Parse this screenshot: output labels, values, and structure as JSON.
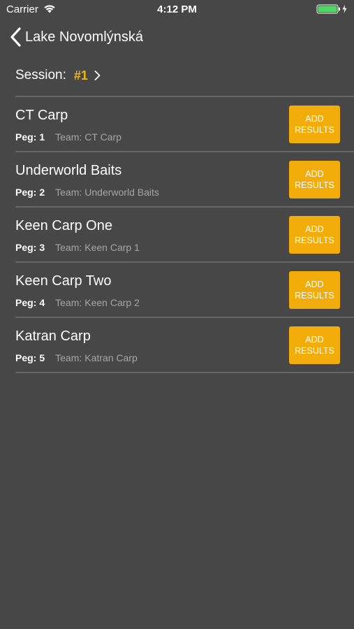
{
  "status_bar": {
    "carrier": "Carrier",
    "time": "4:12 PM",
    "wifi_icon": "wifi-icon",
    "battery_icon": "battery-icon",
    "battery_color": "#4cd964"
  },
  "nav": {
    "back_label": "Lake Novomlýnská",
    "back_icon": "chevron-left-icon"
  },
  "session": {
    "label": "Session:",
    "value": "#1",
    "chevron_icon": "chevron-right-icon",
    "accent_color": "#f2b705"
  },
  "anglers": [
    {
      "name": "CT Carp",
      "peg_label": "Peg:",
      "peg": "1",
      "team_label": "Team:",
      "team": "CT Carp",
      "button_line1": "ADD",
      "button_line2": "RESULTS"
    },
    {
      "name": "Underworld Baits",
      "peg_label": "Peg:",
      "peg": "2",
      "team_label": "Team:",
      "team": "Underworld Baits",
      "button_line1": "ADD",
      "button_line2": "RESULTS"
    },
    {
      "name": "Keen Carp One",
      "peg_label": "Peg:",
      "peg": "3",
      "team_label": "Team:",
      "team": "Keen Carp 1",
      "button_line1": "ADD",
      "button_line2": "RESULTS"
    },
    {
      "name": "Keen Carp Two",
      "peg_label": "Peg:",
      "peg": "4",
      "team_label": "Team:",
      "team": "Keen Carp 2",
      "button_line1": "ADD",
      "button_line2": "RESULTS"
    },
    {
      "name": "Katran Carp",
      "peg_label": "Peg:",
      "peg": "5",
      "team_label": "Team:",
      "team": "Katran Carp",
      "button_line1": "ADD",
      "button_line2": "RESULTS"
    }
  ],
  "colors": {
    "background": "#474747",
    "button": "#f2ad0a",
    "divider": "#666666",
    "secondary_text": "#a6a6a6"
  }
}
